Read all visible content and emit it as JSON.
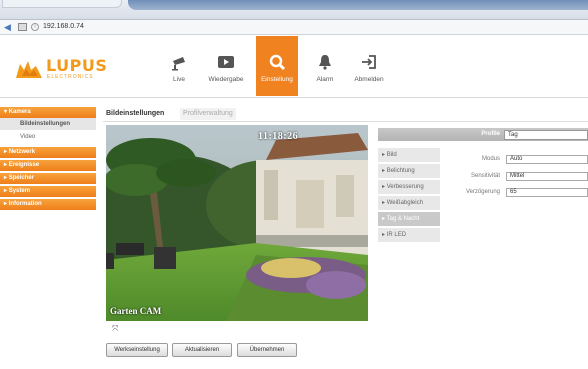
{
  "browser": {
    "address": "192.168.0.74",
    "back_icon": "back-arrow-icon"
  },
  "logo": {
    "brand": "LUPUS",
    "sub": "ELECTRONICS"
  },
  "nav": {
    "items": [
      {
        "label": "Live",
        "icon": "camera-icon"
      },
      {
        "label": "Wiedergabe",
        "icon": "play-icon"
      },
      {
        "label": "Einstellung",
        "icon": "settings-search-icon",
        "active": true
      },
      {
        "label": "Alarm",
        "icon": "bell-icon"
      },
      {
        "label": "Abmelden",
        "icon": "logout-icon"
      }
    ],
    "accent": "#f0821f"
  },
  "sidebar": {
    "kamera": "Kamera",
    "sub_items": [
      "Bildeinstellungen",
      "Video"
    ],
    "items": [
      "Netzwerk",
      "Ereignisse",
      "Speicher",
      "System",
      "Information"
    ]
  },
  "tabs": {
    "active": "Bildeinstellungen",
    "inactive": "Profilverwaltung"
  },
  "camera": {
    "timestamp": "11:18:26",
    "label": "Garten CAM"
  },
  "buttons": {
    "reset": "Werkseinstellung",
    "refresh": "Aktualisieren",
    "apply": "Übernehmen"
  },
  "profile": {
    "label": "Profile",
    "value": "Tag"
  },
  "settings_menu": {
    "items": [
      "Bild",
      "Belichtung",
      "Verbesserung",
      "Weißabgleich",
      "Tag & Nacht",
      "IR LED"
    ],
    "active_index": 4
  },
  "fields": {
    "modus_label": "Modus",
    "modus_value": "Auto",
    "sens_label": "Sensitivität",
    "sens_value": "Mittel",
    "delay_label": "Verzögerung",
    "delay_value": "65"
  }
}
